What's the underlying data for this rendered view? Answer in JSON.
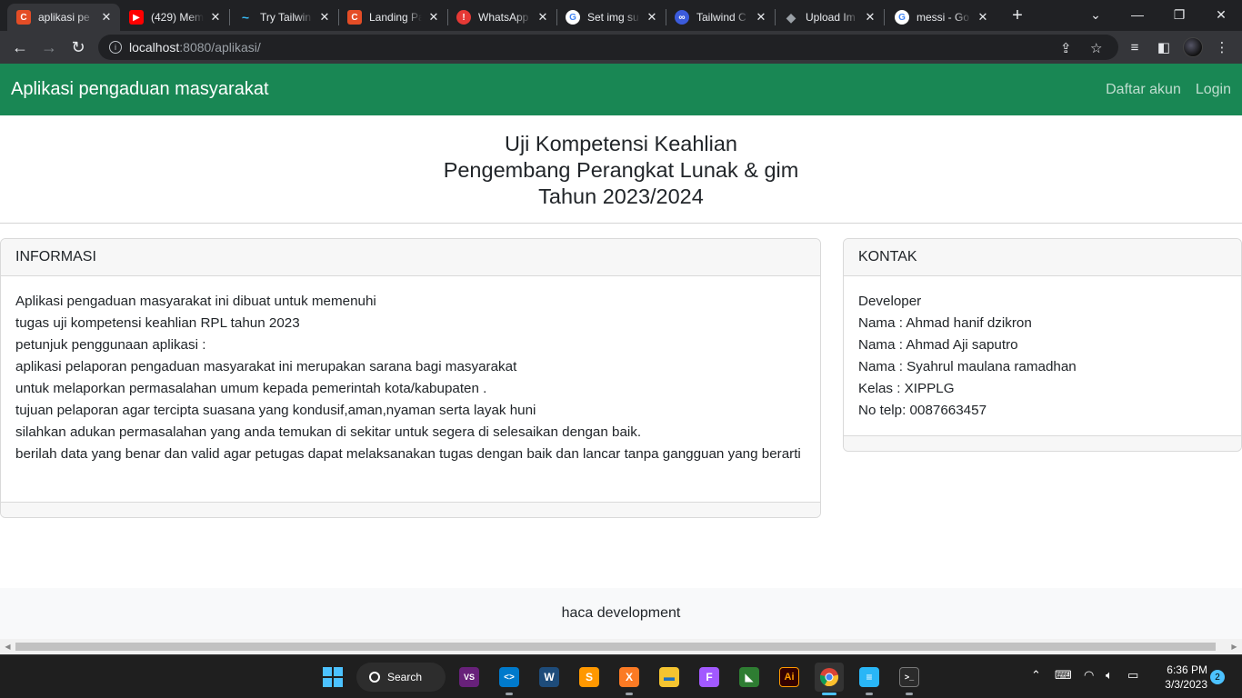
{
  "browser": {
    "tabs": [
      {
        "title": "aplikasi pe",
        "fav_color": "#e44d26",
        "fav_glyph": "C"
      },
      {
        "title": "(429) Mem",
        "fav_color": "#ff0000",
        "fav_glyph": "▶"
      },
      {
        "title": "Try Tailwin",
        "fav_color": "#38bdf8",
        "fav_glyph": "~"
      },
      {
        "title": "Landing Pa",
        "fav_color": "#e44d26",
        "fav_glyph": "C"
      },
      {
        "title": "WhatsApp",
        "fav_color": "#e53935",
        "fav_glyph": "!"
      },
      {
        "title": "Set img su",
        "fav_color": "#ffffff",
        "fav_glyph": "G"
      },
      {
        "title": "Tailwind C",
        "fav_color": "#3b5bdb",
        "fav_glyph": "∞"
      },
      {
        "title": "Upload Im",
        "fav_color": "#9aa0a6",
        "fav_glyph": "◆"
      },
      {
        "title": "messi - Go",
        "fav_color": "#ffffff",
        "fav_glyph": "G"
      }
    ],
    "close_glyph": "✕",
    "new_tab_glyph": "+",
    "url_host": "localhost",
    "url_path": ":8080/aplikasi/"
  },
  "navbar": {
    "brand": "Aplikasi pengaduan masyarakat",
    "links": [
      "Daftar akun",
      "Login"
    ],
    "bg_color": "#198754"
  },
  "heading": {
    "line1": "Uji Kompetensi Keahlian",
    "line2": "Pengembang Perangkat Lunak & gim",
    "line3": "Tahun 2023/2024"
  },
  "info_card": {
    "title": "INFORMASI",
    "lines": [
      "Aplikasi pengaduan masyarakat ini dibuat untuk memenuhi",
      "tugas uji kompetensi keahlian RPL tahun 2023",
      "petunjuk penggunaan aplikasi :",
      "aplikasi pelaporan pengaduan masyarakat ini merupakan sarana bagi masyarakat",
      "untuk melaporkan permasalahan umum kepada pemerintah kota/kabupaten .",
      "tujuan pelaporan agar tercipta suasana yang kondusif,aman,nyaman serta layak huni",
      "silahkan adukan permasalahan yang anda temukan di sekitar untuk segera di selesaikan dengan baik.",
      "berilah data yang benar dan valid agar petugas dapat melaksanakan tugas dengan baik dan lancar tanpa gangguan yang berarti"
    ]
  },
  "contact_card": {
    "title": "KONTAK",
    "lines": [
      "Developer",
      "Nama : Ahmad hanif dzikron",
      "Nama : Ahmad Aji saputro",
      "Nama : Syahrul maulana ramadhan",
      "Kelas : XIPPLG",
      "No telp: 0087663457"
    ]
  },
  "footer": {
    "text": "haca development"
  },
  "taskbar": {
    "search_label": "Search",
    "apps": [
      {
        "name": "visual-studio",
        "color": "#68217a",
        "glyph": "VS"
      },
      {
        "name": "vscode",
        "color": "#007acc",
        "glyph": "<>"
      },
      {
        "name": "mysql-workbench",
        "color": "#1e4c7a",
        "glyph": "W"
      },
      {
        "name": "sublime-text",
        "color": "#ff9800",
        "glyph": "S"
      },
      {
        "name": "xampp",
        "color": "#fb7a24",
        "glyph": "X"
      },
      {
        "name": "file-explorer",
        "color": "#f4c430",
        "glyph": "▬"
      },
      {
        "name": "figma",
        "color": "#a259ff",
        "glyph": "F"
      },
      {
        "name": "inkscape-like",
        "color": "#2e7d32",
        "glyph": "◣"
      },
      {
        "name": "illustrator",
        "color": "#330000",
        "glyph": "Ai"
      },
      {
        "name": "chrome",
        "color": "#4285f4",
        "glyph": "●"
      },
      {
        "name": "notepad",
        "color": "#29b6f6",
        "glyph": "≡"
      },
      {
        "name": "terminal",
        "color": "#2b2b2b",
        "glyph": ">_"
      }
    ],
    "time": "6:36 PM",
    "date": "3/3/2023",
    "notifications": "2"
  }
}
